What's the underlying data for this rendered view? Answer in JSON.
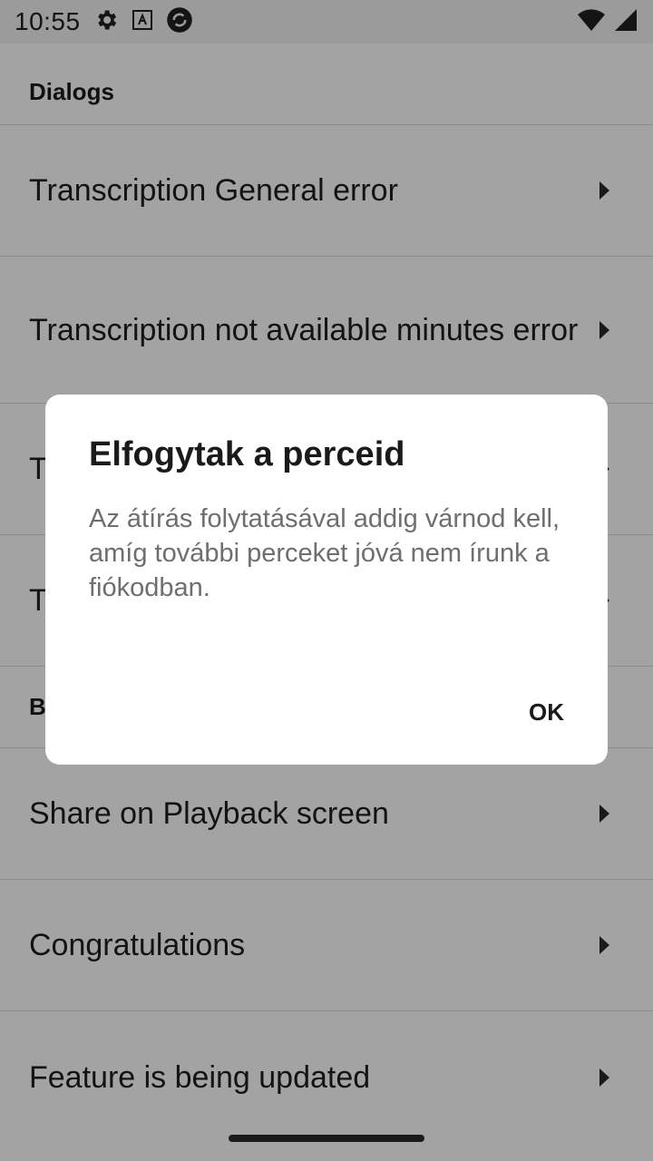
{
  "status_bar": {
    "time": "10:55",
    "icons_left": [
      "gear-icon",
      "font-a-icon",
      "sync-app-icon"
    ],
    "icons_right": [
      "wifi-icon",
      "signal-icon"
    ]
  },
  "list": {
    "section_dialogs": "Dialogs",
    "items": [
      {
        "label": "Transcription General error"
      },
      {
        "label": "Transcription not available minutes error"
      },
      {
        "label": "T"
      },
      {
        "label": "T"
      }
    ],
    "section_b": "B",
    "items_after": [
      {
        "label": "Share on Playback screen"
      },
      {
        "label": "Congratulations"
      },
      {
        "label": "Feature is being updated"
      }
    ]
  },
  "dialog": {
    "title": "Elfogytak a perceid",
    "message": "Az átírás folytatásával addig várnod kell, amíg további perceket jóvá nem írunk a fiókodban.",
    "ok_label": "OK"
  },
  "colors": {
    "background": "#ffffff",
    "scrim": "rgba(0,0,0,0.36)",
    "dialog": "#ffffff",
    "text_primary": "#1a1a1a",
    "text_secondary": "#6e6e6e"
  }
}
